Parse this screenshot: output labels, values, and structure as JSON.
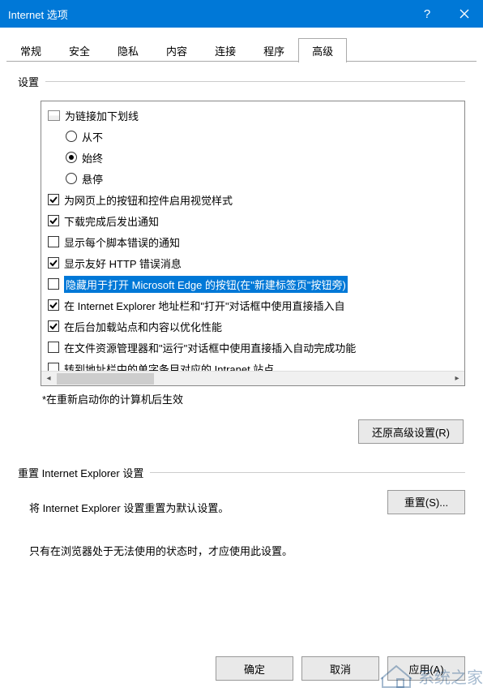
{
  "titlebar": {
    "title": "Internet 选项"
  },
  "tabs": [
    "常规",
    "安全",
    "隐私",
    "内容",
    "连接",
    "程序",
    "高级"
  ],
  "active_tab_index": 6,
  "settings": {
    "label": "设置",
    "tree": {
      "parent_label": "为链接加下划线",
      "radios": [
        {
          "label": "从不",
          "checked": false
        },
        {
          "label": "始终",
          "checked": true
        },
        {
          "label": "悬停",
          "checked": false
        }
      ],
      "checks": [
        {
          "label": "为网页上的按钮和控件启用视觉样式",
          "checked": true,
          "selected": false
        },
        {
          "label": "下载完成后发出通知",
          "checked": true,
          "selected": false
        },
        {
          "label": "显示每个脚本错误的通知",
          "checked": false,
          "selected": false
        },
        {
          "label": "显示友好 HTTP 错误消息",
          "checked": true,
          "selected": false
        },
        {
          "label": "隐藏用于打开 Microsoft Edge 的按钮(在\"新建标签页\"按钮旁)",
          "checked": false,
          "selected": true
        },
        {
          "label": "在 Internet Explorer 地址栏和\"打开\"对话框中使用直接插入自",
          "checked": true,
          "selected": false
        },
        {
          "label": "在后台加载站点和内容以优化性能",
          "checked": true,
          "selected": false
        },
        {
          "label": "在文件资源管理器和\"运行\"对话框中使用直接插入自动完成功能",
          "checked": false,
          "selected": false
        },
        {
          "label": "转到地址栏中的单字条目对应的 Intranet 站点",
          "checked": false,
          "selected": false
        }
      ]
    },
    "note": "*在重新启动你的计算机后生效",
    "restore_button": "还原高级设置(R)"
  },
  "reset": {
    "label": "重置 Internet Explorer 设置",
    "desc": "将 Internet Explorer 设置重置为默认设置。",
    "button": "重置(S)...",
    "warning": "只有在浏览器处于无法使用的状态时，才应使用此设置。"
  },
  "dialog": {
    "ok": "确定",
    "cancel": "取消",
    "apply": "应用(A)"
  },
  "watermark": "系统之家"
}
